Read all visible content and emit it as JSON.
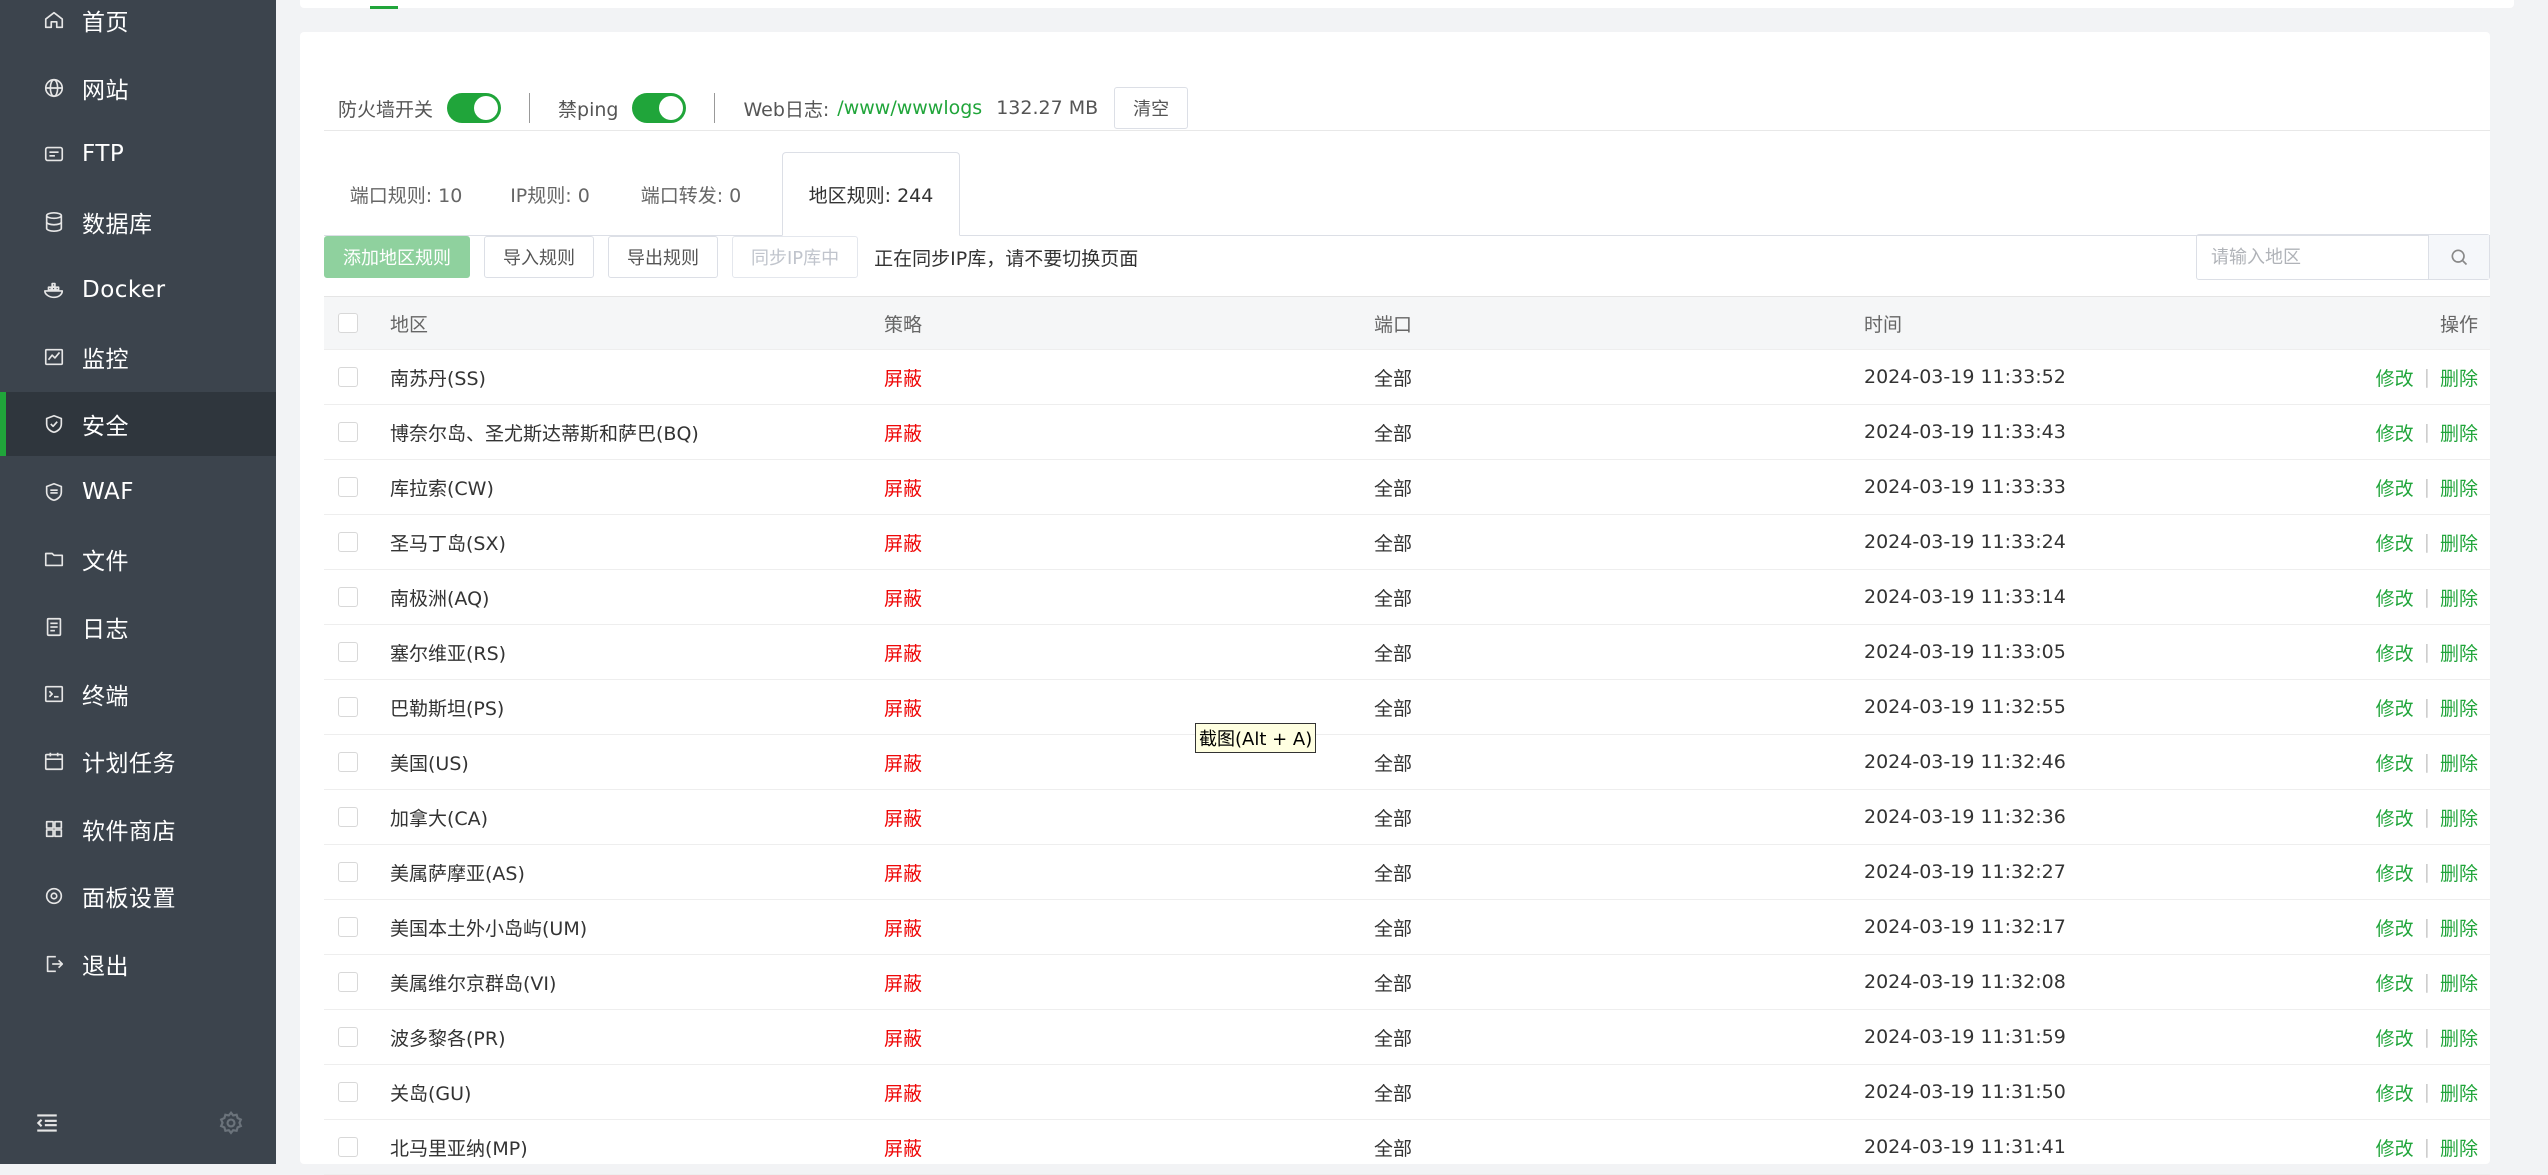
{
  "sidebar": {
    "items": [
      {
        "label": "首页",
        "icon": "home-icon",
        "active": false
      },
      {
        "label": "网站",
        "icon": "globe-icon",
        "active": false
      },
      {
        "label": "FTP",
        "icon": "ftp-icon",
        "active": false
      },
      {
        "label": "数据库",
        "icon": "database-icon",
        "active": false
      },
      {
        "label": "Docker",
        "icon": "docker-icon",
        "active": false
      },
      {
        "label": "监控",
        "icon": "monitor-icon",
        "active": false
      },
      {
        "label": "安全",
        "icon": "shield-icon",
        "active": true
      },
      {
        "label": "WAF",
        "icon": "waf-shield-icon",
        "active": false
      },
      {
        "label": "文件",
        "icon": "folder-icon",
        "active": false
      },
      {
        "label": "日志",
        "icon": "log-icon",
        "active": false
      },
      {
        "label": "终端",
        "icon": "terminal-icon",
        "active": false
      },
      {
        "label": "计划任务",
        "icon": "calendar-icon",
        "active": false
      },
      {
        "label": "软件商店",
        "icon": "apps-icon",
        "active": false
      },
      {
        "label": "面板设置",
        "icon": "gear-icon",
        "active": false
      },
      {
        "label": "退出",
        "icon": "logout-icon",
        "active": false
      }
    ],
    "footer": {
      "collapse_icon": "menu-collapse-icon",
      "settings_icon": "settings-icon"
    }
  },
  "toolbar": {
    "firewall_label": "防火墙开关",
    "firewall_on": true,
    "ping_label": "禁ping",
    "ping_on": true,
    "weblog_label": "Web日志:",
    "weblog_path": "/www/wwwlogs",
    "weblog_size": "132.27 MB",
    "clear_label": "清空"
  },
  "tabs": [
    {
      "label": "端口规则: 10",
      "active": false
    },
    {
      "label": "IP规则: 0",
      "active": false
    },
    {
      "label": "端口转发: 0",
      "active": false
    },
    {
      "label": "地区规则: 244",
      "active": true
    }
  ],
  "actions": {
    "add_label": "添加地区规则",
    "import_label": "导入规则",
    "export_label": "导出规则",
    "sync_label": "同步IP库中",
    "sync_status": "正在同步IP库，请不要切换页面",
    "search_placeholder": "请输入地区"
  },
  "table": {
    "headers": {
      "region": "地区",
      "policy": "策略",
      "port": "端口",
      "time": "时间",
      "ops": "操作"
    },
    "edit_label": "修改",
    "delete_label": "删除",
    "rows": [
      {
        "region": "南苏丹(SS)",
        "policy": "屏蔽",
        "port": "全部",
        "time": "2024-03-19 11:33:52"
      },
      {
        "region": "博奈尔岛、圣尤斯达蒂斯和萨巴(BQ)",
        "policy": "屏蔽",
        "port": "全部",
        "time": "2024-03-19 11:33:43"
      },
      {
        "region": "库拉索(CW)",
        "policy": "屏蔽",
        "port": "全部",
        "time": "2024-03-19 11:33:33"
      },
      {
        "region": "圣马丁岛(SX)",
        "policy": "屏蔽",
        "port": "全部",
        "time": "2024-03-19 11:33:24"
      },
      {
        "region": "南极洲(AQ)",
        "policy": "屏蔽",
        "port": "全部",
        "time": "2024-03-19 11:33:14"
      },
      {
        "region": "塞尔维亚(RS)",
        "policy": "屏蔽",
        "port": "全部",
        "time": "2024-03-19 11:33:05"
      },
      {
        "region": "巴勒斯坦(PS)",
        "policy": "屏蔽",
        "port": "全部",
        "time": "2024-03-19 11:32:55"
      },
      {
        "region": "美国(US)",
        "policy": "屏蔽",
        "port": "全部",
        "time": "2024-03-19 11:32:46"
      },
      {
        "region": "加拿大(CA)",
        "policy": "屏蔽",
        "port": "全部",
        "time": "2024-03-19 11:32:36"
      },
      {
        "region": "美属萨摩亚(AS)",
        "policy": "屏蔽",
        "port": "全部",
        "time": "2024-03-19 11:32:27"
      },
      {
        "region": "美国本土外小岛屿(UM)",
        "policy": "屏蔽",
        "port": "全部",
        "time": "2024-03-19 11:32:17"
      },
      {
        "region": "美属维尔京群岛(VI)",
        "policy": "屏蔽",
        "port": "全部",
        "time": "2024-03-19 11:32:08"
      },
      {
        "region": "波多黎各(PR)",
        "policy": "屏蔽",
        "port": "全部",
        "time": "2024-03-19 11:31:59"
      },
      {
        "region": "关岛(GU)",
        "policy": "屏蔽",
        "port": "全部",
        "time": "2024-03-19 11:31:50"
      },
      {
        "region": "北马里亚纳(MP)",
        "policy": "屏蔽",
        "port": "全部",
        "time": "2024-03-19 11:31:41"
      }
    ]
  },
  "tooltip": {
    "text": "截图(Alt + A)"
  },
  "colors": {
    "accent": "#20a53a",
    "danger": "#ef0808",
    "sidebar_bg": "#3c444d"
  }
}
